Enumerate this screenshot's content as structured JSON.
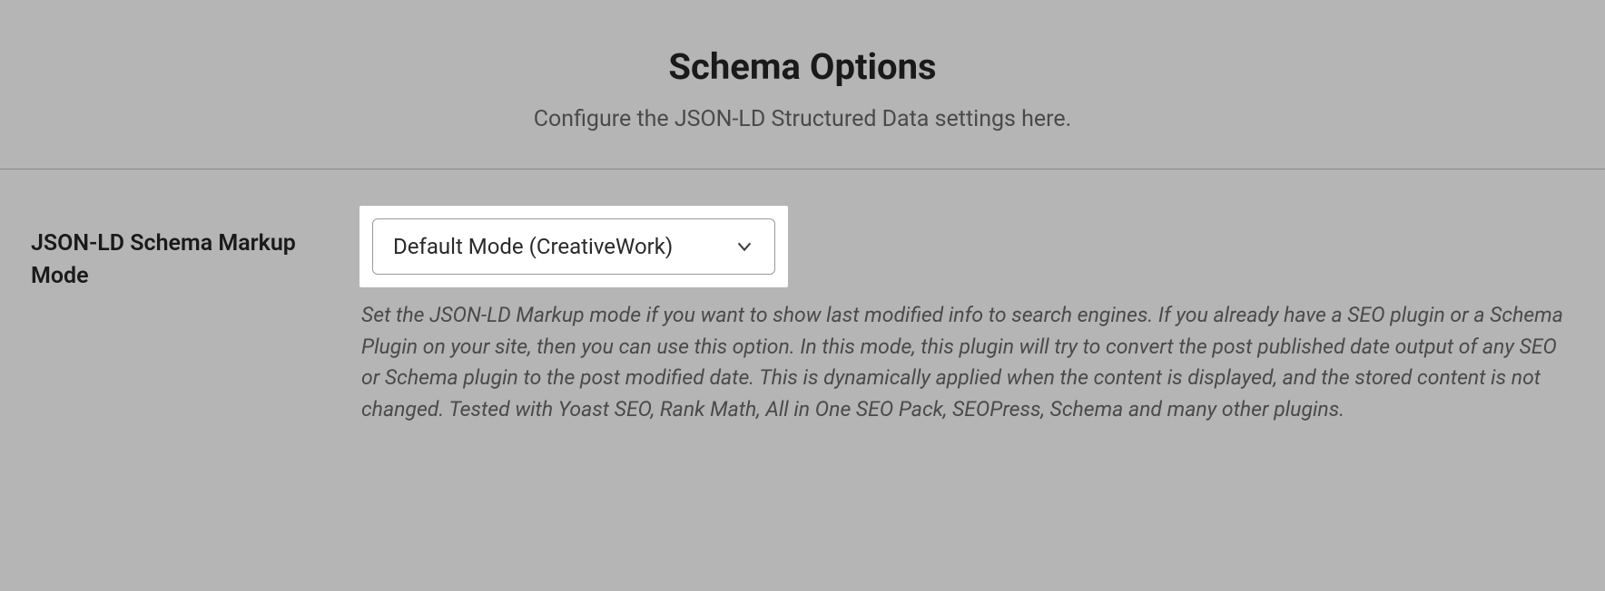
{
  "header": {
    "title": "Schema Options",
    "subtitle": "Configure the JSON-LD Structured Data settings here."
  },
  "setting": {
    "label": "JSON-LD Schema Markup Mode",
    "selected_value": "Default Mode (CreativeWork)",
    "help_text": "Set the JSON-LD Markup mode if you want to show last modified info to search engines. If you already have a SEO plugin or a Schema Plugin on your site, then you can use this option. In this mode, this plugin will try to convert the post published date output of any SEO or Schema plugin to the post modified date. This is dynamically applied when the content is displayed, and the stored content is not changed. Tested with Yoast SEO, Rank Math, All in One SEO Pack, SEOPress, Schema and many other plugins."
  }
}
